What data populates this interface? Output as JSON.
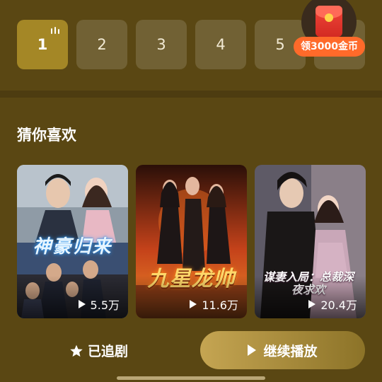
{
  "episodes": {
    "items": [
      {
        "label": "1",
        "active": true
      },
      {
        "label": "2",
        "active": false
      },
      {
        "label": "3",
        "active": false
      },
      {
        "label": "4",
        "active": false
      },
      {
        "label": "5",
        "active": false
      }
    ]
  },
  "reward": {
    "badge": "领3000金币",
    "icon": "red-envelope-icon"
  },
  "recommend": {
    "title": "猜你喜欢",
    "cards": [
      {
        "poster_title": "神豪归来",
        "views": "5.5万"
      },
      {
        "poster_title": "九星龙帅",
        "views": "11.6万"
      },
      {
        "poster_title": "谋妻入局：总裁深夜求欢",
        "views": "20.4万"
      }
    ]
  },
  "actions": {
    "followed_label": "已追剧",
    "followed_icon": "star-icon",
    "continue_label": "继续播放",
    "continue_icon": "play-icon"
  },
  "colors": {
    "background": "#5a4713",
    "active_episode": "#a48726",
    "reward_badge": "#ff6a2a",
    "continue_button": "#c5a552"
  }
}
